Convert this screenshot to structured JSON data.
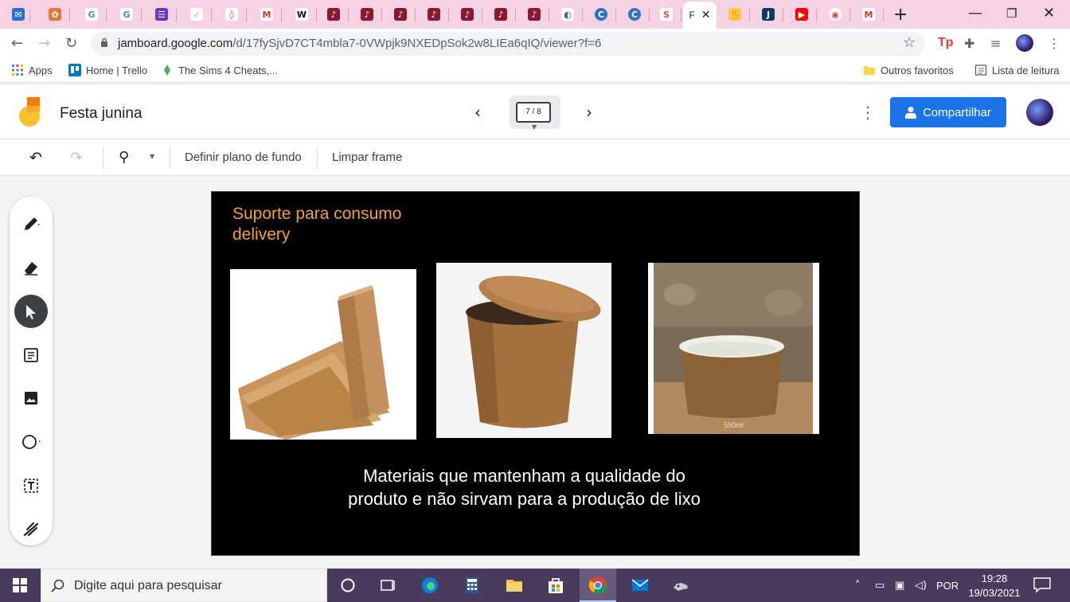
{
  "browser": {
    "url_host": "jamboard.google.com",
    "url_path": "/d/17fySjvD7CT4mbla7-0VWpjk9NXEDpSok2w8LIEa6qIQ/viewer?f=6",
    "active_tab_letter": "F",
    "bookmarks": [
      {
        "label": "Apps"
      },
      {
        "label": "Home | Trello"
      },
      {
        "label": "The Sims 4 Cheats,..."
      }
    ],
    "other_bookmarks": "Outros favoritos",
    "reading_list": "Lista de leitura"
  },
  "jamboard": {
    "title": "Festa junina",
    "frame_indicator": "7 / 8",
    "share_label": "Compartilhar",
    "toolbar": {
      "set_background": "Definir plano de fundo",
      "clear_frame": "Limpar frame"
    },
    "frame": {
      "heading": "Suporte para consumo delivery",
      "caption": "Materiais que mantenham a qualidade do produto e não sirvam para a produção de lixo",
      "photo_label": "550ml"
    }
  },
  "taskbar": {
    "search_placeholder": "Digite aqui para pesquisar",
    "language": "POR",
    "time": "19:28",
    "date": "19/03/2021"
  },
  "colors": {
    "heading": "#f3a32d",
    "share": "#1a73e8",
    "tabstrip": "#f6d3e4",
    "taskbar": "#4a3b5e"
  }
}
